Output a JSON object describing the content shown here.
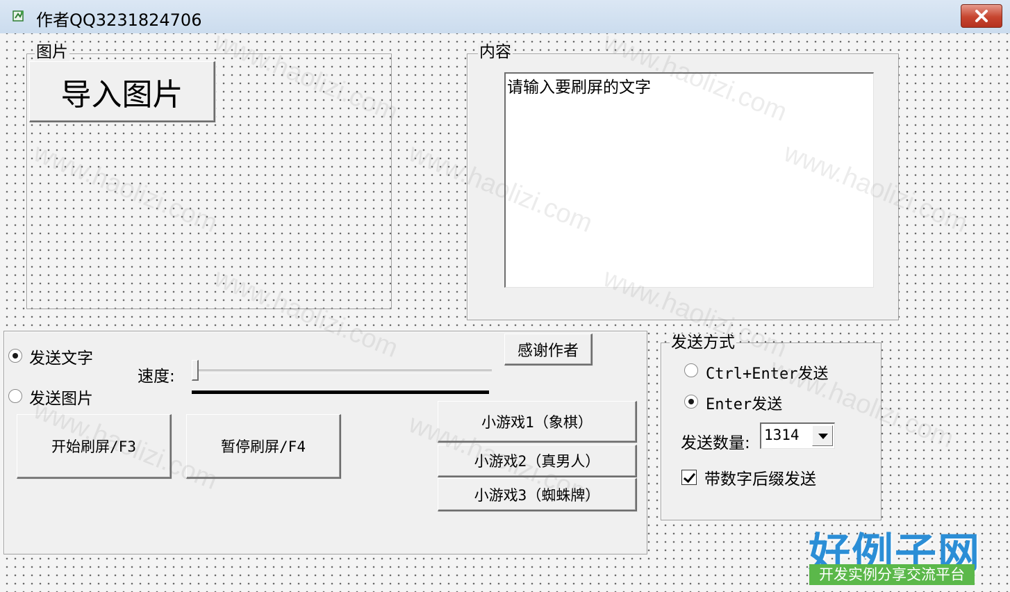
{
  "window": {
    "title": "作者QQ3231824706",
    "icon": "app-icon"
  },
  "picture_group": {
    "label": "图片",
    "import_button": "导入图片"
  },
  "content_group": {
    "label": "内容",
    "text_value": "请输入要刷屏的文字"
  },
  "send_type": {
    "send_text_label": "发送文字",
    "send_text_checked": true,
    "send_image_label": "发送图片",
    "send_image_checked": false
  },
  "speed": {
    "label": "速度:",
    "value_fraction": 0.0
  },
  "buttons": {
    "thank_author": "感谢作者",
    "start": "开始刷屏/F3",
    "pause": "暂停刷屏/F4",
    "game1": "小游戏1（象棋）",
    "game2": "小游戏2（真男人）",
    "game3": "小游戏3（蜘蛛牌）"
  },
  "send_method": {
    "label": "发送方式",
    "option1_label": "Ctrl+Enter发送",
    "option1_checked": false,
    "option2_label": "Enter发送",
    "option2_checked": true,
    "count_label": "发送数量:",
    "count_value": "1314",
    "suffix_label": "带数字后缀发送",
    "suffix_checked": true
  },
  "watermark_text": "www.haolizi.com",
  "logo": {
    "main": "好例子网",
    "sub": "开发实例分享交流平台"
  }
}
